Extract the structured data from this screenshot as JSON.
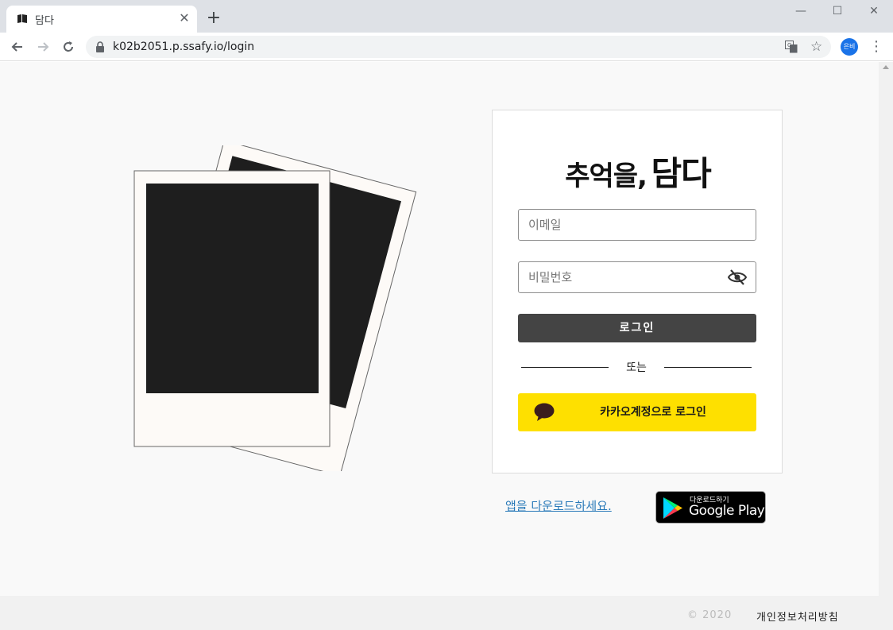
{
  "browser": {
    "tab_title": "담다",
    "tab_close": "✕",
    "new_tab": "+",
    "url": "k02b2051.p.ssafy.io/login",
    "profile_label": "은비",
    "window_min": "—",
    "window_max": "☐",
    "window_close": "✕"
  },
  "login": {
    "title_part1": "추억을,",
    "title_part2": "담다",
    "email_placeholder": "이메일",
    "password_placeholder": "비밀번호",
    "login_button": "로그인",
    "divider_text": "또는",
    "kakao_button": "카카오계정으로 로그인"
  },
  "app_download": {
    "link_text": "앱을 다운로드하세요.",
    "badge_small": "다운로드하기",
    "badge_big": "Google Play"
  },
  "footer": {
    "copyright": "© 2020",
    "privacy_link": "개인정보처리방침"
  },
  "colors": {
    "kakao_yellow": "#fee000",
    "login_button": "#444444",
    "link_blue": "#2a7ab9",
    "background": "#f9f9f9"
  }
}
